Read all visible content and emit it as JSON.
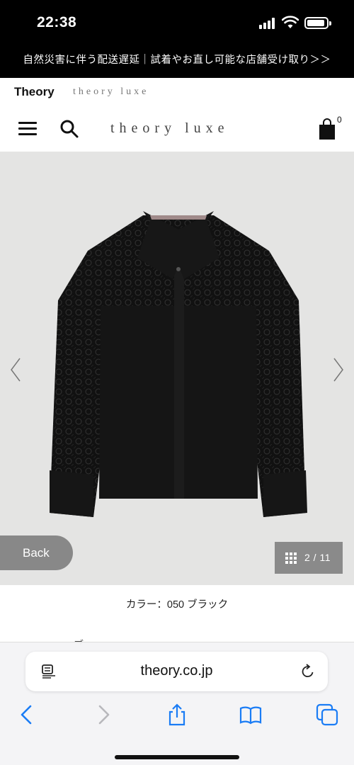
{
  "status_bar": {
    "time": "22:38"
  },
  "announcement": {
    "text": "自然災害に伴う配送遅延｜試着やお直し可能な店舗受け取り＞＞"
  },
  "brand_tabs": {
    "theory": "Theory",
    "luxe": "theory luxe"
  },
  "header": {
    "logo": "theory luxe",
    "cart_count": "0"
  },
  "gallery": {
    "back_label": "Back",
    "counter": "2 / 11",
    "current_image": 2,
    "total_images": 11
  },
  "product": {
    "color_label": "カラー：050 ブラック",
    "partial_text": "ブ..."
  },
  "browser": {
    "url": "theory.co.jp"
  },
  "icons": {
    "menu": "hamburger-menu-icon",
    "search": "search-icon",
    "cart": "shopping-bag-icon",
    "reader": "reader-mode-icon",
    "reload": "reload-icon",
    "back": "chevron-left-icon",
    "forward": "chevron-right-icon",
    "share": "share-icon",
    "bookmarks": "book-icon",
    "tabs": "tabs-icon"
  },
  "colors": {
    "background": "#ffffff",
    "announcement_bg": "#000000",
    "gallery_bg": "#e4e4e3",
    "accent_blue": "#1a7cf5"
  }
}
